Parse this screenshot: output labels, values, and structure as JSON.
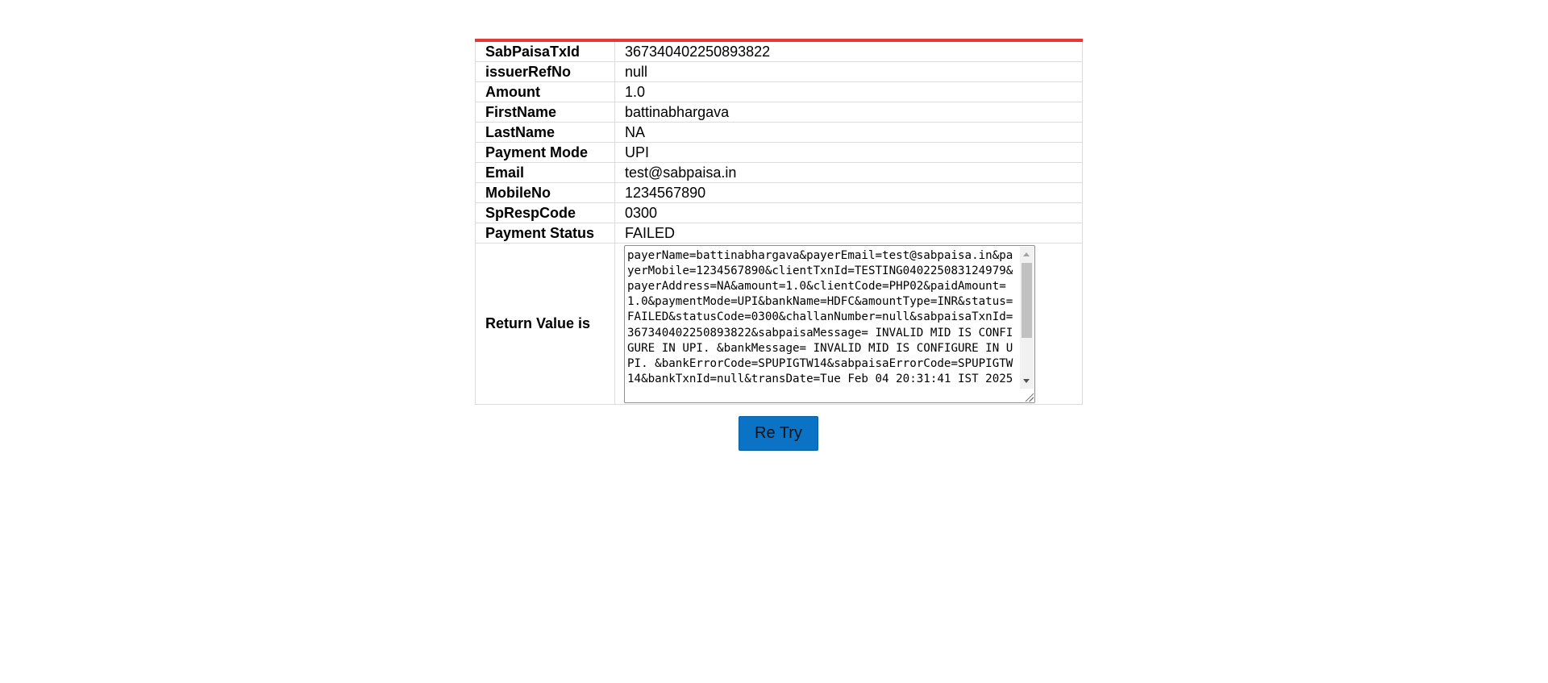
{
  "rows": [
    {
      "label": "SabPaisaTxId",
      "value": "367340402250893822"
    },
    {
      "label": "issuerRefNo",
      "value": "null"
    },
    {
      "label": "Amount",
      "value": "1.0"
    },
    {
      "label": "FirstName",
      "value": "battinabhargava"
    },
    {
      "label": "LastName",
      "value": "NA"
    },
    {
      "label": "Payment Mode",
      "value": "UPI"
    },
    {
      "label": "Email",
      "value": "test@sabpaisa.in"
    },
    {
      "label": "MobileNo",
      "value": "1234567890"
    },
    {
      "label": "SpRespCode",
      "value": "0300"
    },
    {
      "label": "Payment Status",
      "value": "FAILED"
    }
  ],
  "return_value": {
    "label": "Return Value is",
    "text": "payerName=battinabhargava&payerEmail=test@sabpaisa.in&payerMobile=1234567890&clientTxnId=TESTING040225083124979&payerAddress=NA&amount=1.0&clientCode=PHP02&paidAmount=1.0&paymentMode=UPI&bankName=HDFC&amountType=INR&status=FAILED&statusCode=0300&challanNumber=null&sabpaisaTxnId=367340402250893822&sabpaisaMessage= INVALID MID IS CONFIGURE IN UPI. &bankMessage= INVALID MID IS CONFIGURE IN UPI. &bankErrorCode=SPUPIGTW14&sabpaisaErrorCode=SPUPIGTW14&bankTxnId=null&transDate=Tue Feb 04 20:31:41 IST 2025"
  },
  "retry_label": "Re Try",
  "colors": {
    "accent_border": "#e53935",
    "button": "#0a73c5"
  }
}
